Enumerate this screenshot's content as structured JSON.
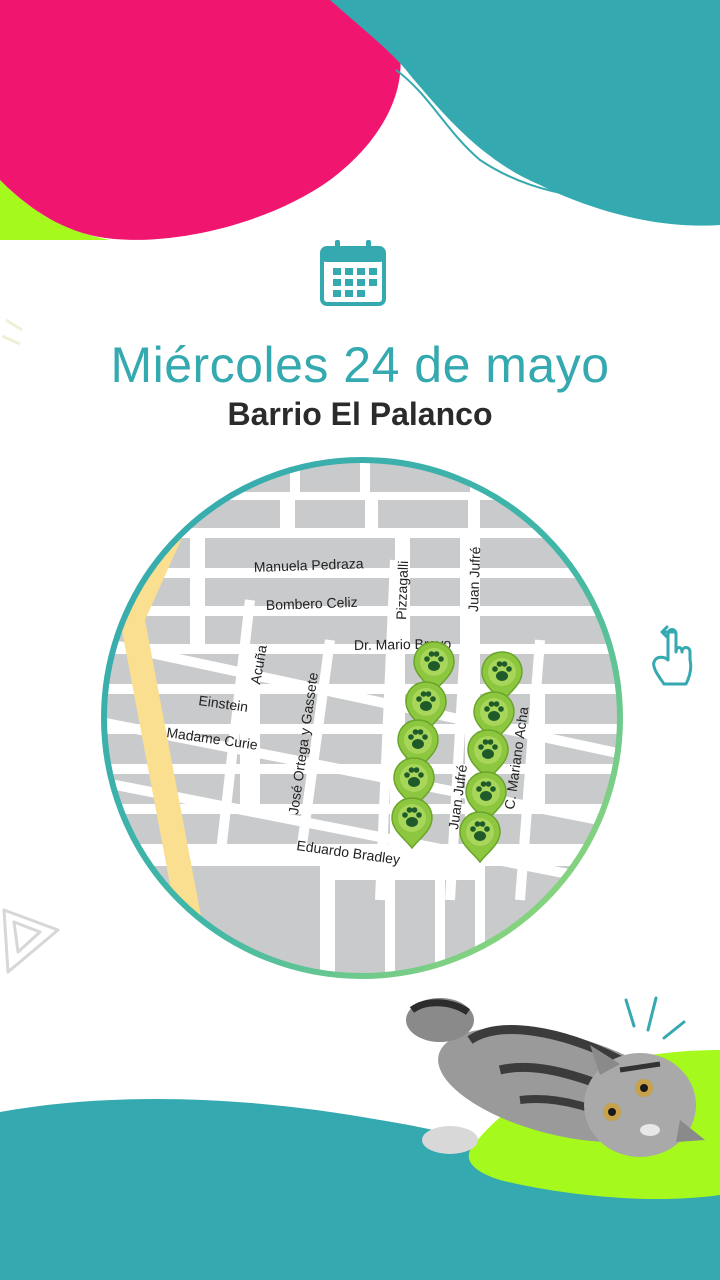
{
  "header": {
    "date": "Miércoles 24 de mayo",
    "neighborhood": "Barrio El Palanco"
  },
  "colors": {
    "teal": "#35a9b0",
    "pink": "#f0156e",
    "lime": "#a6f91c",
    "marker_green": "#8dc63f",
    "street_gray": "#c9cacb"
  },
  "icons": {
    "calendar": "calendar-icon",
    "swipe": "swipe-gesture-icon",
    "play": "play-outline-icon",
    "marker": "paw-marker-icon"
  },
  "map": {
    "streets": [
      "Manuela Pedraza",
      "Bombero Celiz",
      "Pizzagalli",
      "Juan Jufré",
      "Dr. Mario Bravo",
      "Acuña",
      "Einstein",
      "Madame Curie",
      "José Ortega y Gassete",
      "Juan Jufré",
      "C. Mariano Acha",
      "Eduardo Bradley"
    ],
    "marker_count": 10
  }
}
